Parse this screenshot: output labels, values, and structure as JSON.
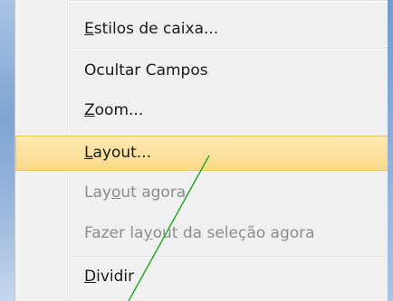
{
  "menu": {
    "items": [
      {
        "pre": "",
        "u": "E",
        "post": "stilos de caixa...",
        "disabled": false
      },
      {
        "pre": "Ocultar Campos",
        "u": "",
        "post": "",
        "disabled": false
      },
      {
        "pre": "",
        "u": "Z",
        "post": "oom...",
        "disabled": false
      },
      {
        "pre": "",
        "u": "L",
        "post": "ayout...",
        "disabled": false,
        "highlighted": true
      },
      {
        "pre": "Lay",
        "u": "o",
        "post": "ut agora",
        "disabled": true
      },
      {
        "pre": "Fazer la",
        "u": "y",
        "post": "out da seleção agora",
        "disabled": true
      },
      {
        "pre": "",
        "u": "D",
        "post": "ividir",
        "disabled": false
      }
    ]
  },
  "colors": {
    "highlight_top": "#fde9b2",
    "highlight_bottom": "#fbd98c",
    "highlight_border": "#f1c35f",
    "annotation_line": "#1ea51e"
  }
}
